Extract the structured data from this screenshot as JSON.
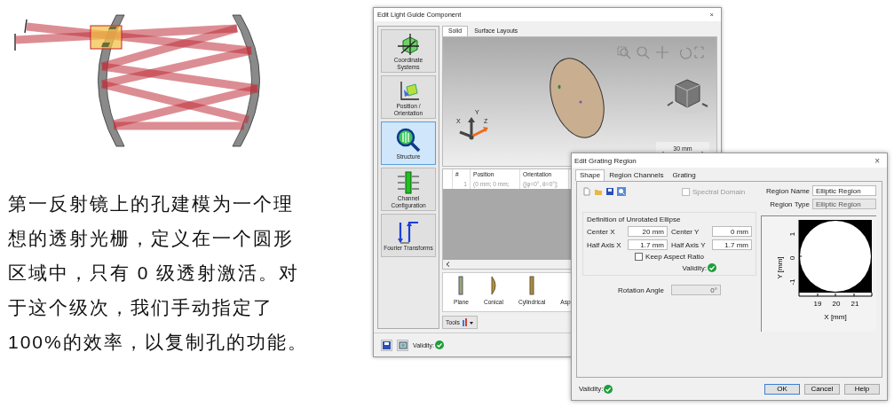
{
  "caption": "第一反射镜上的孔建模为一个理想的透射光栅，定义在一个圆形区域中，只有 0 级透射激活。对于这个级次，我们手动指定了100%的效率，以复制孔的功能。",
  "main_window": {
    "title": "Edit Light Guide Component",
    "close": "×",
    "sidebar": [
      {
        "label": "Coordinate Systems",
        "selected": false
      },
      {
        "label": "Position / Orientation",
        "selected": false
      },
      {
        "label": "Structure",
        "selected": true
      },
      {
        "label": "Channel Configuration",
        "selected": false
      },
      {
        "label": "Fourier Transforms",
        "selected": false
      }
    ],
    "tabs": [
      {
        "label": "Solid",
        "selected": true
      },
      {
        "label": "Surface Layouts",
        "selected": false
      }
    ],
    "view": {
      "axes": [
        "X",
        "Y",
        "Z"
      ],
      "scale": "30 mm"
    },
    "table": {
      "columns": [
        "#",
        "Position",
        "Orientation"
      ],
      "rows": [
        [
          "1",
          "(0 mm; 0 mm;",
          "([φ=0°, θ=0°];"
        ]
      ]
    },
    "shapes": [
      "Plane",
      "Conical",
      "Cylindrical",
      "Asp"
    ],
    "tools": "Tools",
    "validity": "Validity:"
  },
  "grating_window": {
    "title": "Edit Grating Region",
    "close": "×",
    "tabs": [
      {
        "label": "Shape",
        "selected": true
      },
      {
        "label": "Region Channels",
        "selected": false
      },
      {
        "label": "Grating",
        "selected": false
      }
    ],
    "spectral_domain": {
      "label": "Spectral Domain",
      "checked": false,
      "disabled": true
    },
    "region_name": {
      "label": "Region Name",
      "value": "Elliptic Region",
      "disabled": false
    },
    "region_type": {
      "label": "Region Type",
      "value": "Elliptic Region",
      "disabled": true
    },
    "group_title": "Definition of Unrotated Ellipse",
    "fields": [
      {
        "label": "Center X",
        "value": "20 mm"
      },
      {
        "label": "Center Y",
        "value": "0 mm"
      },
      {
        "label": "Half Axis X",
        "value": "1.7 mm"
      },
      {
        "label": "Half Axis Y",
        "value": "1.7 mm"
      }
    ],
    "keep_aspect": {
      "label": "Keep Aspect Ratio",
      "checked": false,
      "disabled": false
    },
    "group_validity": "Validity:",
    "rotation": {
      "label": "Rotation Angle",
      "value": "0°",
      "disabled": true
    },
    "plot": {
      "ylabel": "Y [mm]",
      "yticks": [
        "1",
        "0",
        "-1"
      ],
      "xticks": [
        "19",
        "20",
        "21"
      ],
      "xlabel": "X [mm]"
    },
    "validity": "Validity:",
    "buttons": [
      "OK",
      "Cancel",
      "Help"
    ]
  }
}
